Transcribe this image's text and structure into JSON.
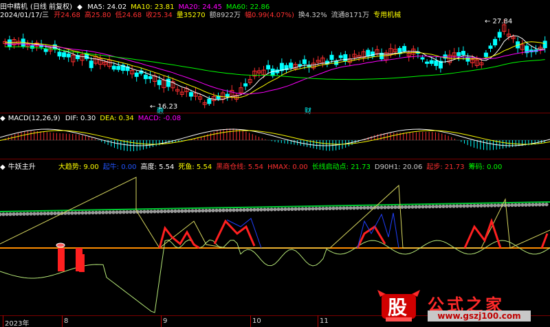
{
  "header": {
    "name": "田中精机",
    "mode": "(日线 前复权)",
    "ma": [
      {
        "label": "MA5: 24.02",
        "color": "#ffffff"
      },
      {
        "label": "MA10: 23.81",
        "color": "#ffff00"
      },
      {
        "label": "MA20: 24.45",
        "color": "#ff00ff"
      },
      {
        "label": "MA60: 22.86",
        "color": "#00ff00"
      }
    ],
    "date": "2024/01/17/三",
    "quote": [
      {
        "label": "开24.68",
        "color": "#ff3030"
      },
      {
        "label": "高25.80",
        "color": "#ff3030"
      },
      {
        "label": "低24.68",
        "color": "#ff3030"
      },
      {
        "label": "收25.34",
        "color": "#ff3030"
      },
      {
        "label": "量35270",
        "color": "#ffff00"
      },
      {
        "label": "额8922万",
        "color": "#cccccc"
      },
      {
        "label": "幅0.99(4.07%)",
        "color": "#ff3030"
      },
      {
        "label": "换4.32%",
        "color": "#cccccc"
      },
      {
        "label": "流通8171万",
        "color": "#cccccc"
      },
      {
        "label": "专用机械",
        "color": "#ffff00"
      }
    ],
    "high_label": "27.84",
    "low_label": "16.23",
    "event_a": "融",
    "event_b": "财"
  },
  "macd": {
    "title": "MACD(12,26,9)",
    "items": [
      {
        "label": "DIF: 0.30",
        "color": "#ffffff"
      },
      {
        "label": "DEA: 0.34",
        "color": "#ffff00"
      },
      {
        "label": "MACD: -0.08",
        "color": "#ff00ff"
      }
    ]
  },
  "ind": {
    "title": "牛妖主升",
    "items": [
      {
        "label": "大趋势: 9.00",
        "color": "#ffff00"
      },
      {
        "label": "起牛: 0.00",
        "color": "#2255ff"
      },
      {
        "label": "高度: 5.54",
        "color": "#ffffff"
      },
      {
        "label": "死鱼: 5.54",
        "color": "#ffff00"
      },
      {
        "label": "黑商仓线: 5.54",
        "color": "#ff3030"
      },
      {
        "label": "HMAX: 0.00",
        "color": "#ff3030"
      },
      {
        "label": "长线启动点: 21.73",
        "color": "#00ff00"
      },
      {
        "label": "D90H1: 20.06",
        "color": "#cccccc"
      },
      {
        "label": "起步: 21.73",
        "color": "#ff3030"
      },
      {
        "label": "筹码: 0.00",
        "color": "#00ff00"
      }
    ]
  },
  "xaxis": [
    {
      "label": "2023年",
      "pos": 0.005
    },
    {
      "label": "8",
      "pos": 0.113
    },
    {
      "label": "9",
      "pos": 0.292
    },
    {
      "label": "10",
      "pos": 0.455
    },
    {
      "label": "11",
      "pos": 0.578
    }
  ],
  "watermark": {
    "logo_char": "股",
    "text": "公式之家",
    "url": "www.gszj100.com"
  },
  "colors": {
    "up": "#ff3030",
    "down": "#00ffff",
    "separator": "#7a0000"
  }
}
